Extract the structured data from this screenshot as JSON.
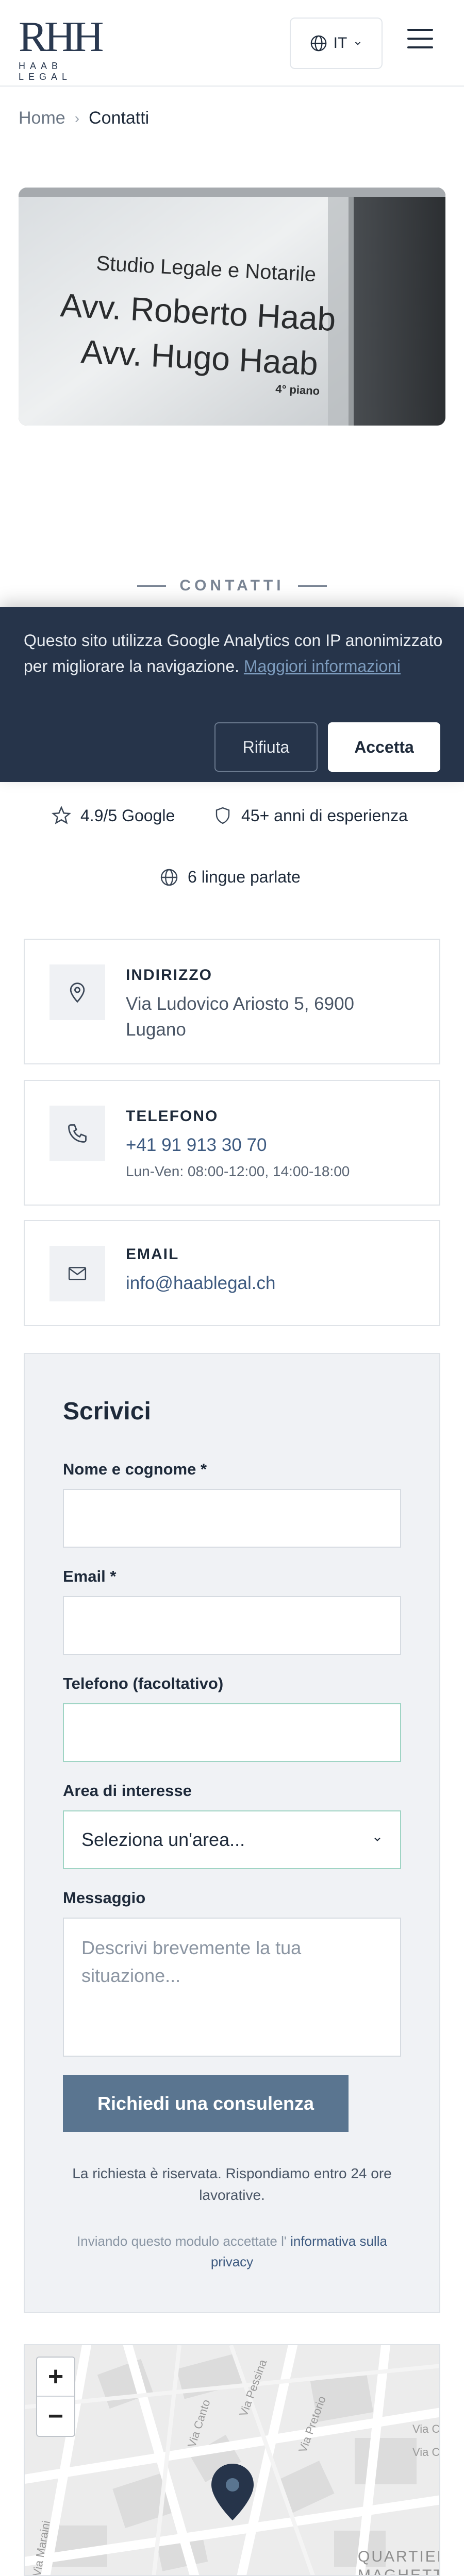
{
  "header": {
    "logo_mark": "RHH",
    "logo_text": "HAAB LEGAL",
    "language": "IT"
  },
  "breadcrumb": {
    "home": "Home",
    "current": "Contatti"
  },
  "photo": {
    "line1": "Studio Legale e Notarile",
    "line2": "Avv. Roberto Haab",
    "line3": "Avv. Hugo Haab",
    "floor": "4° piano"
  },
  "section": {
    "label": "CONTATTI"
  },
  "cookie": {
    "text": "Questo sito utilizza Google Analytics con IP anonimizzato per migliorare la navigazione.",
    "link": "Maggiori informazioni",
    "reject": "Rifiuta",
    "accept": "Accetta"
  },
  "stats": {
    "rating": "4.9/5 Google",
    "experience": "45+ anni di esperienza",
    "languages": "6 lingue parlate"
  },
  "contacts": {
    "address_title": "INDIRIZZO",
    "address_line1": "Via Ludovico Ariosto 5, 6900",
    "address_line2": "Lugano",
    "phone_title": "TELEFONO",
    "phone_value": "+41 91 913 30 70",
    "phone_hours": "Lun-Ven: 08:00-12:00, 14:00-18:00",
    "email_title": "EMAIL",
    "email_value": "info@haablegal.ch"
  },
  "form": {
    "title": "Scrivici",
    "name_label": "Nome e cognome *",
    "email_label": "Email *",
    "phone_label": "Telefono (facoltativo)",
    "area_label": "Area di interesse",
    "area_placeholder": "Seleziona un'area...",
    "message_label": "Messaggio",
    "message_placeholder_line1": "Descrivi brevemente la tua",
    "message_placeholder_line2": "situazione...",
    "submit": "Richiedi una consulenza",
    "note": "La richiesta è riservata. Rispondiamo entro 24 ore lavorative.",
    "privacy_prefix": "Inviando questo modulo accettate l'",
    "privacy_link": "informativa sulla privacy"
  },
  "map": {
    "zoom_in": "+",
    "zoom_out": "−",
    "street1": "Via Canto",
    "street2": "Via Pessina",
    "street3": "Via Pretorio",
    "street4": "Via Cu",
    "street5": "Via Ce",
    "street6": "Via Maraini",
    "district_line1": "QUARTIER",
    "district_line2": "MAGHETT"
  },
  "colors": {
    "navy": "#26344a",
    "accent": "#5a7590",
    "link": "#3d5a80"
  }
}
